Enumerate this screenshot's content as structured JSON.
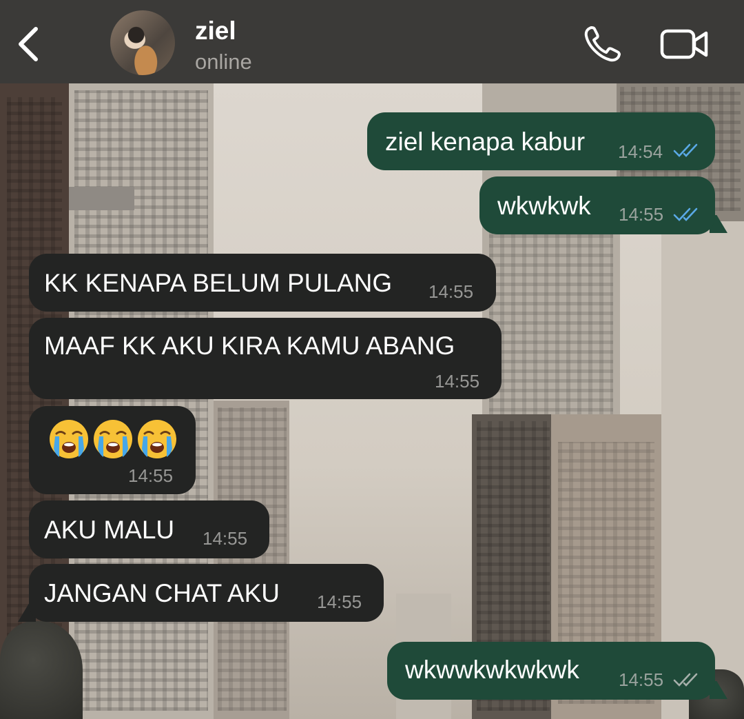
{
  "header": {
    "contact_name": "ziel",
    "status": "online",
    "icons": {
      "back": "back-chevron-icon",
      "call": "phone-icon",
      "video": "video-camera-icon"
    }
  },
  "colors": {
    "header_bg": "#3b3a38",
    "outgoing_bubble": "#1f4a39",
    "incoming_bubble": "#232423",
    "read_ticks": "#5aa9e6",
    "delivered_ticks": "#a7b0ab"
  },
  "messages": [
    {
      "direction": "out",
      "text": "ziel kenapa kabur",
      "time": "14:54",
      "status": "read"
    },
    {
      "direction": "out",
      "text": "wkwkwk",
      "time": "14:55",
      "status": "read"
    },
    {
      "direction": "in",
      "text": "KK KENAPA BELUM PULANG",
      "time": "14:55"
    },
    {
      "direction": "in",
      "text": "MAAF KK AKU KIRA KAMU ABANG",
      "time": "14:55"
    },
    {
      "direction": "in",
      "text": "",
      "emojis": [
        "loudly-crying-face",
        "loudly-crying-face",
        "loudly-crying-face"
      ],
      "time": "14:55"
    },
    {
      "direction": "in",
      "text": "AKU MALU",
      "time": "14:55"
    },
    {
      "direction": "in",
      "text": "JANGAN CHAT AKU",
      "time": "14:55"
    },
    {
      "direction": "out",
      "text": "wkwwkwkwkwk",
      "time": "14:55",
      "status": "delivered"
    }
  ]
}
